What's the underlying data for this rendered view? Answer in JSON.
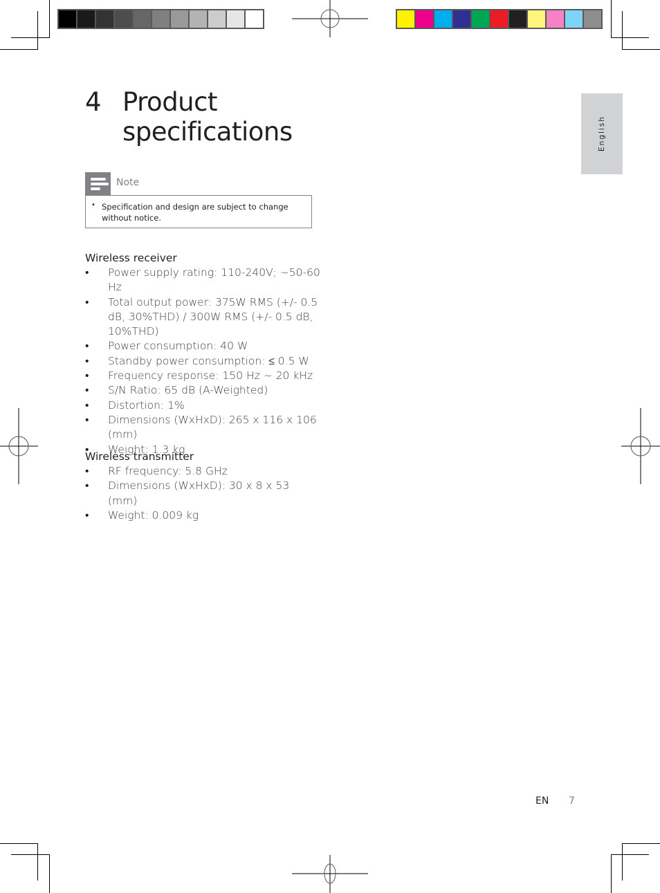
{
  "print_marks": {
    "grayscale_bar": [
      "#000000",
      "#1a1a1a",
      "#333333",
      "#4d4d4d",
      "#666666",
      "#808080",
      "#999999",
      "#b3b3b3",
      "#cccccc",
      "#e6e6e6",
      "#ffffff"
    ],
    "color_bar": [
      "#fff200",
      "#ec008c",
      "#00aeef",
      "#2e3192",
      "#00a651",
      "#ed1c24",
      "#231f20",
      "#fff57a",
      "#f582c4",
      "#7dd4f7",
      "#8e8e8e"
    ]
  },
  "language_tab": "English",
  "chapter": {
    "number": "4",
    "title": "Product specifications"
  },
  "note": {
    "icon": "note-lines-icon",
    "label": "Note",
    "items": [
      "Specification and design are subject to change without notice."
    ]
  },
  "sections": [
    {
      "heading": "Wireless receiver",
      "items": [
        "Power supply rating: 110-240V; ~50-60 Hz",
        "Total output power: 375W RMS (+/- 0.5 dB, 30%THD) / 300W RMS (+/- 0.5 dB, 10%THD)",
        "Power consumption: 40 W",
        "Standby power consumption: ≤ 0.5 W",
        "Frequency response: 150 Hz ~ 20 kHz",
        "S/N Ratio: 65 dB (A-Weighted)",
        "Distortion: 1%",
        "Dimensions (WxHxD): 265 x 116 x 106 (mm)",
        "Weight: 1.3 kg"
      ]
    },
    {
      "heading": "Wireless transmitter",
      "items": [
        "RF frequency: 5.8 GHz",
        "Dimensions (WxHxD): 30 x 8 x 53 (mm)",
        "Weight: 0.009 kg"
      ]
    }
  ],
  "footer": {
    "language": "EN",
    "page_number": "7"
  },
  "bullet_char": "•"
}
